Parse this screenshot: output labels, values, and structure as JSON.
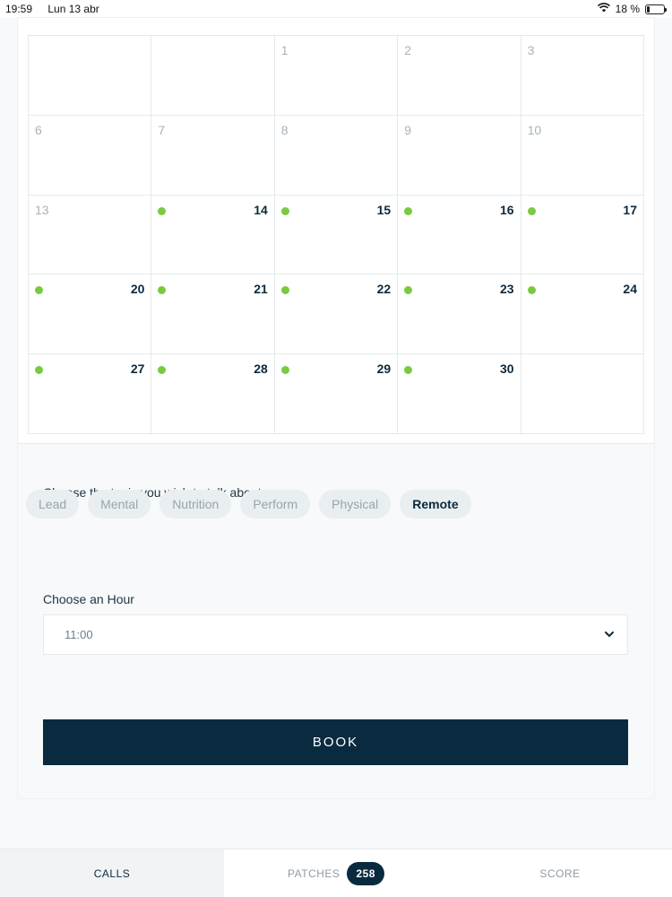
{
  "status_bar": {
    "time": "19:59",
    "date": "Lun 13 abr",
    "battery_pct": "18 %",
    "battery_level": 0.18
  },
  "calendar": {
    "accent_color": "#7ac943",
    "days": [
      {
        "label": "",
        "state": "empty"
      },
      {
        "label": "",
        "state": "empty"
      },
      {
        "label": "1",
        "state": "muted"
      },
      {
        "label": "2",
        "state": "muted"
      },
      {
        "label": "3",
        "state": "muted"
      },
      {
        "label": "6",
        "state": "muted"
      },
      {
        "label": "7",
        "state": "muted"
      },
      {
        "label": "8",
        "state": "muted"
      },
      {
        "label": "9",
        "state": "muted"
      },
      {
        "label": "10",
        "state": "muted"
      },
      {
        "label": "13",
        "state": "muted"
      },
      {
        "label": "14",
        "state": "available"
      },
      {
        "label": "15",
        "state": "available"
      },
      {
        "label": "16",
        "state": "available"
      },
      {
        "label": "17",
        "state": "available"
      },
      {
        "label": "20",
        "state": "available"
      },
      {
        "label": "21",
        "state": "available"
      },
      {
        "label": "22",
        "state": "available"
      },
      {
        "label": "23",
        "state": "available"
      },
      {
        "label": "24",
        "state": "available"
      },
      {
        "label": "27",
        "state": "available"
      },
      {
        "label": "28",
        "state": "available"
      },
      {
        "label": "29",
        "state": "available"
      },
      {
        "label": "30",
        "state": "available"
      },
      {
        "label": "",
        "state": "empty"
      }
    ]
  },
  "topics": {
    "label": "Choose the topic you wish to talk about",
    "items": [
      "Lead",
      "Mental",
      "Nutrition",
      "Perform",
      "Physical",
      "Remote"
    ],
    "selected": "Remote"
  },
  "hour": {
    "label": "Choose an Hour",
    "value": "11:00"
  },
  "book_button": {
    "label": "BOOK"
  },
  "tabbar": {
    "calls": "CALLS",
    "patches": "PATCHES",
    "patches_count": "258",
    "score": "SCORE"
  }
}
